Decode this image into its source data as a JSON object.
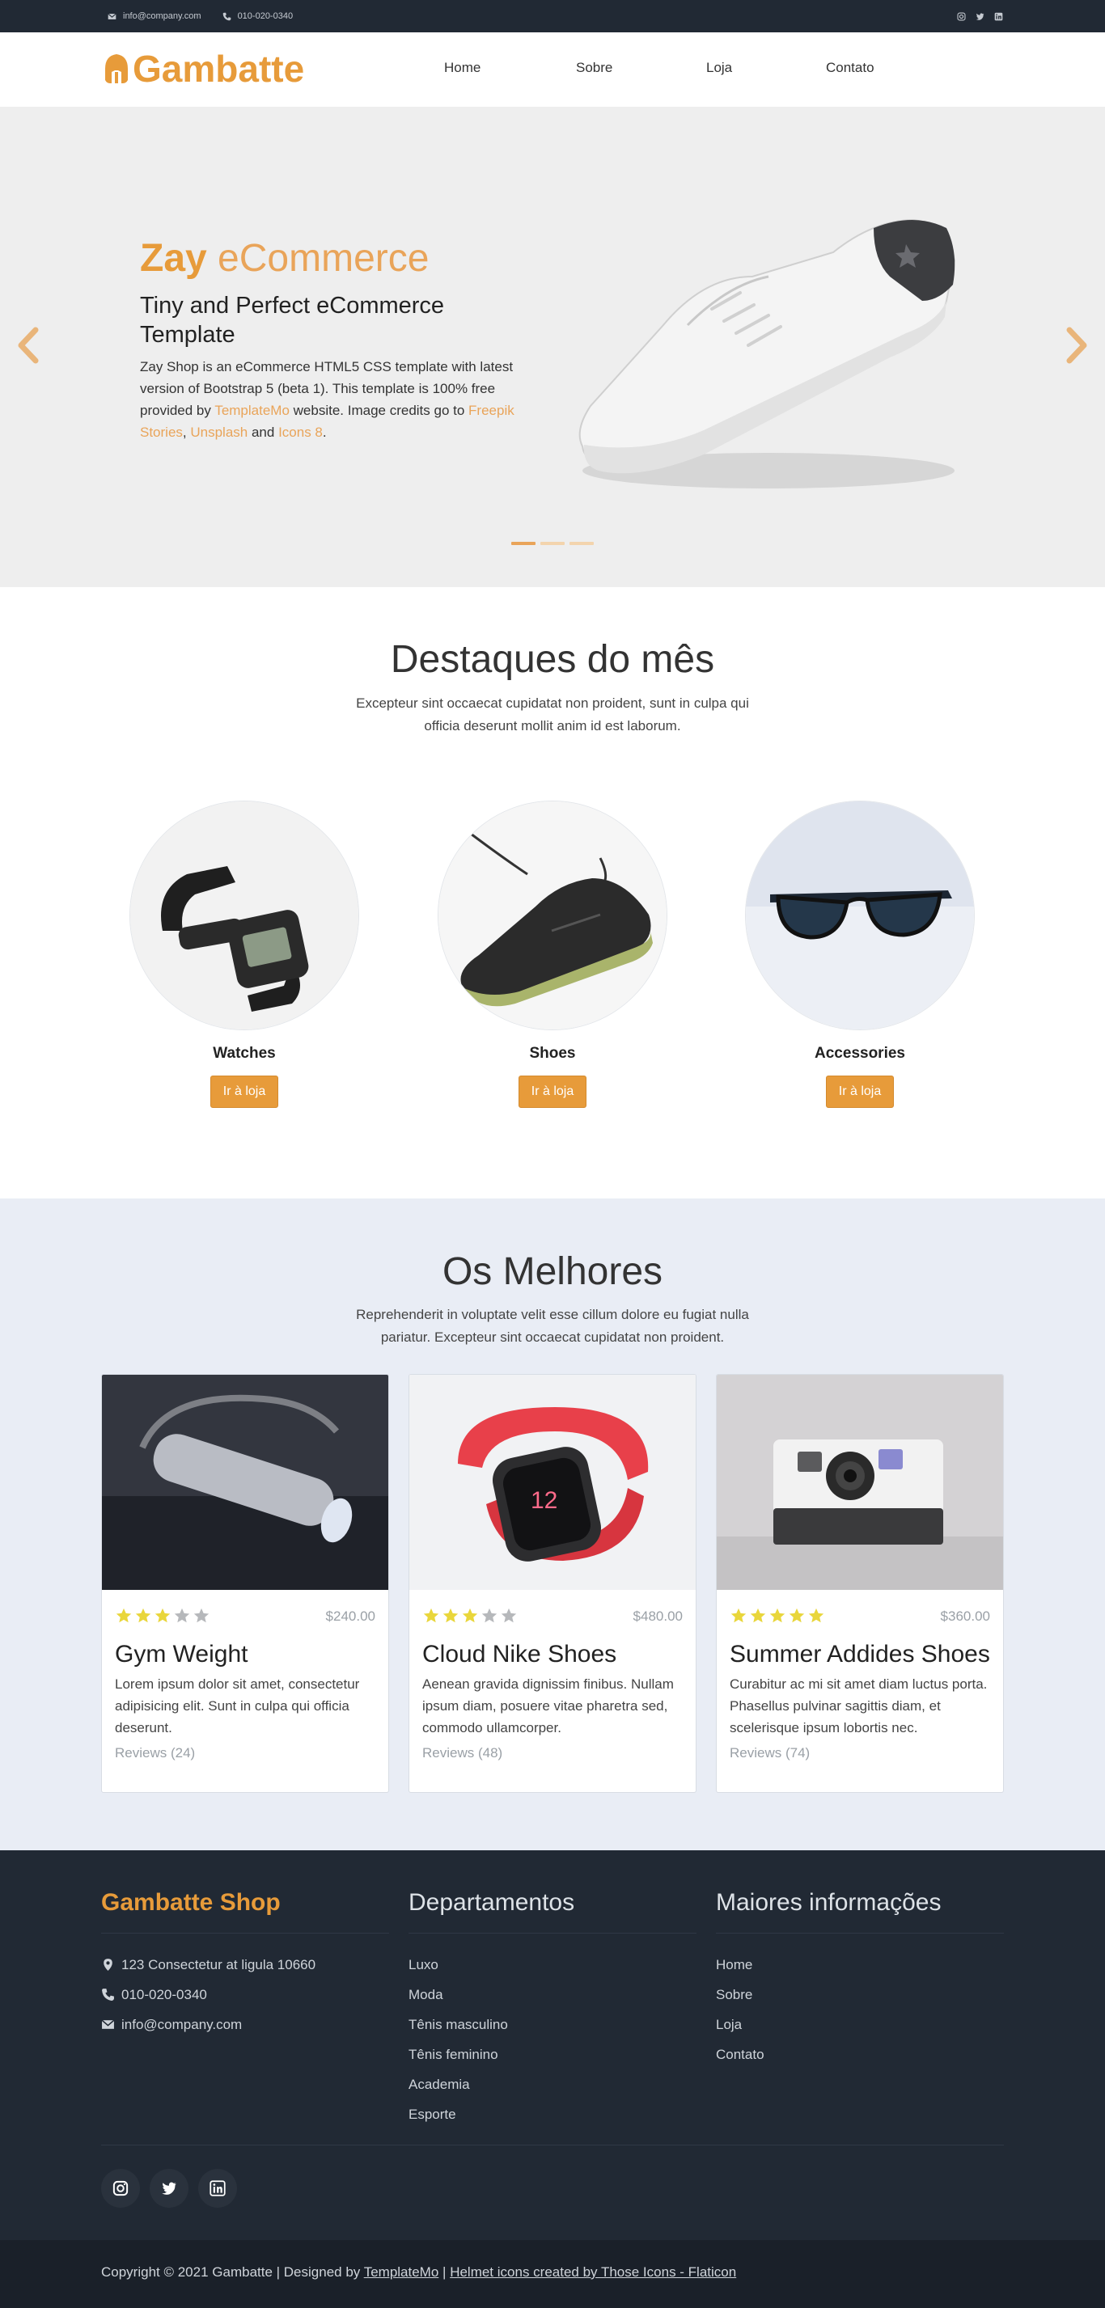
{
  "topbar": {
    "email": "info@company.com",
    "phone": "010-020-0340",
    "social": [
      "instagram-icon",
      "twitter-icon",
      "linkedin-icon"
    ]
  },
  "nav": {
    "brand": "Gambatte",
    "menu": [
      "Home",
      "Sobre",
      "Loja",
      "Contato"
    ]
  },
  "hero": {
    "title_bold": "Zay",
    "title_rest": " eCommerce",
    "subtitle": "Tiny and Perfect eCommerce Template",
    "text_1": "Zay Shop is an eCommerce HTML5 CSS template with latest version of Bootstrap 5 (beta 1). This template is 100% free provided by ",
    "link_templatemo": "TemplateMo",
    "text_2": " website. Image credits go to ",
    "link_freepik": "Freepik Stories",
    "text_3": ", ",
    "link_unsplash": "Unsplash",
    "text_4": " and ",
    "link_icons8": "Icons 8",
    "text_5": ".",
    "slides": 3,
    "active_slide": 1
  },
  "featured": {
    "title": "Destaques do mês",
    "subtitle": "Excepteur sint occaecat cupidatat non proident, sunt in culpa qui officia deserunt mollit anim id est laborum.",
    "categories": [
      {
        "name": "Watches",
        "button": "Ir à loja"
      },
      {
        "name": "Shoes",
        "button": "Ir à loja"
      },
      {
        "name": "Accessories",
        "button": "Ir à loja"
      }
    ]
  },
  "best": {
    "title": "Os Melhores",
    "subtitle": "Reprehenderit in voluptate velit esse cillum dolore eu fugiat nulla pariatur. Excepteur sint occaecat cupidatat non proident.",
    "products": [
      {
        "name": "Gym Weight",
        "price": "$240.00",
        "rating": 3,
        "description": "Lorem ipsum dolor sit amet, consectetur adipisicing elit. Sunt in culpa qui officia deserunt.",
        "reviews": "Reviews (24)"
      },
      {
        "name": "Cloud Nike Shoes",
        "price": "$480.00",
        "rating": 3,
        "description": "Aenean gravida dignissim finibus. Nullam ipsum diam, posuere vitae pharetra sed, commodo ullamcorper.",
        "reviews": "Reviews (48)"
      },
      {
        "name": "Summer Addides Shoes",
        "price": "$360.00",
        "rating": 5,
        "description": "Curabitur ac mi sit amet diam luctus porta. Phasellus pulvinar sagittis diam, et scelerisque ipsum lobortis nec.",
        "reviews": "Reviews (74)"
      }
    ]
  },
  "footer": {
    "shop_title": "Gambatte Shop",
    "address": "123 Consectetur at ligula 10660",
    "phone": "010-020-0340",
    "email": "info@company.com",
    "departments_title": "Departamentos",
    "departments": [
      "Luxo",
      "Moda",
      "Tênis masculino",
      "Tênis feminino",
      "Academia",
      "Esporte"
    ],
    "info_title": "Maiores informações",
    "info_links": [
      "Home",
      "Sobre",
      "Loja",
      "Contato"
    ],
    "copyright_prefix": "Copyright © 2021 Gambatte | Designed by ",
    "copyright_link1": "TemplateMo",
    "copyright_sep": " | ",
    "copyright_link2": "Helmet icons created by Those Icons - Flaticon"
  },
  "colors": {
    "accent": "#e79b3a",
    "dark": "#212934",
    "light_bg": "#e9edf5",
    "star": "#e9d63b"
  }
}
